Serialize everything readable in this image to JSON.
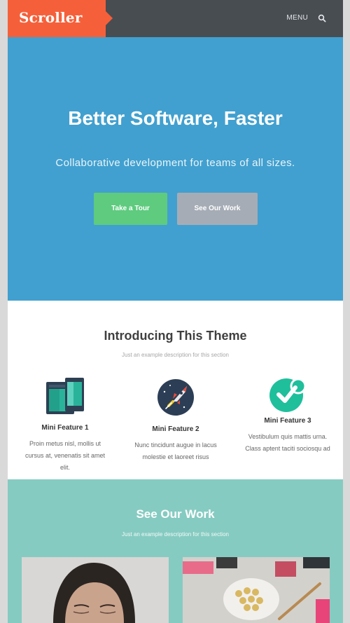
{
  "header": {
    "logo": "Scroller",
    "menu_label": "MENU",
    "search_icon": "search-icon"
  },
  "hero": {
    "title": "Better Software, Faster",
    "subtitle": "Collaborative development for teams of all sizes.",
    "primary_button": "Take a Tour",
    "secondary_button": "See Our Work"
  },
  "intro": {
    "title": "Introducing This Theme",
    "description": "Just an example description for this section",
    "features": [
      {
        "title": "Mini Feature 1",
        "text": "Proin metus nisl, mollis ut cursus at, venenatis sit amet elit.",
        "icon": "devices-icon"
      },
      {
        "title": "Mini Feature 2",
        "text": "Nunc tincidunt augue in lacus molestie et laoreet risus",
        "icon": "rocket-icon"
      },
      {
        "title": "Mini Feature 3",
        "text": "Vestibulum quis mattis urna. Class aptent taciti sociosqu ad",
        "icon": "checkmark-badge-icon"
      }
    ]
  },
  "work": {
    "title": "See Our Work",
    "description": "Just an example description for this section"
  },
  "colors": {
    "accent": "#f5603a",
    "header": "#484d52",
    "hero": "#41a0cf",
    "tour_button": "#5ecb7f",
    "work_button": "#a6acb5",
    "work_section": "#86cbc1"
  }
}
